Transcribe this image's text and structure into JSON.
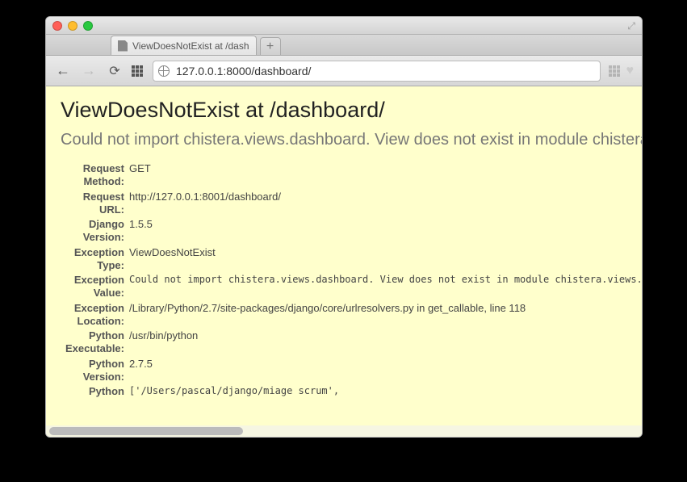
{
  "tab": {
    "title": "ViewDoesNotExist at /dash"
  },
  "address": {
    "url": "127.0.0.1:8000/dashboard/"
  },
  "page": {
    "heading": "ViewDoesNotExist at /dashboard/",
    "subtitle": "Could not import chistera.views.dashboard. View does not exist in module chistera.views."
  },
  "meta": {
    "request_method": {
      "label": "Request Method:",
      "value": "GET"
    },
    "request_url": {
      "label": "Request URL:",
      "value": "http://127.0.0.1:8001/dashboard/"
    },
    "django_version": {
      "label": "Django Version:",
      "value": "1.5.5"
    },
    "exception_type": {
      "label": "Exception Type:",
      "value": "ViewDoesNotExist"
    },
    "exception_value": {
      "label": "Exception Value:",
      "value": "Could not import chistera.views.dashboard. View does not exist in module chistera.views."
    },
    "exception_location": {
      "label": "Exception Location:",
      "value": "/Library/Python/2.7/site-packages/django/core/urlresolvers.py in get_callable, line 118"
    },
    "python_executable": {
      "label": "Python Executable:",
      "value": "/usr/bin/python"
    },
    "python_version": {
      "label": "Python Version:",
      "value": "2.7.5"
    },
    "python_path": {
      "label": "Python",
      "value": "['/Users/pascal/django/miage scrum',"
    }
  }
}
